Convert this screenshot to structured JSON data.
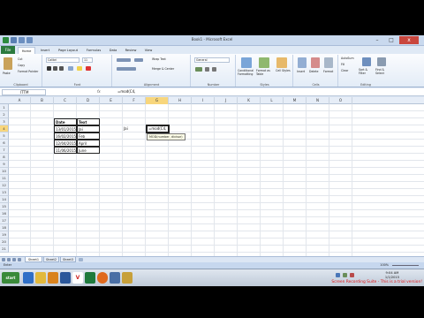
{
  "window": {
    "title": "Book1 - Microsoft Excel",
    "min": "–",
    "max": "□",
    "close": "x"
  },
  "tabs": [
    "File",
    "Home",
    "Insert",
    "Page Layout",
    "Formulas",
    "Data",
    "Review",
    "View"
  ],
  "ribbon": {
    "clipboard": {
      "label": "Clipboard",
      "paste": "Paste",
      "cut": "Cut",
      "copy": "Copy",
      "format_painter": "Format Painter"
    },
    "font": {
      "label": "Font",
      "font_name": "Calibri",
      "font_size": "11"
    },
    "alignment": {
      "label": "Alignment",
      "wrap": "Wrap Text",
      "merge": "Merge & Center"
    },
    "number": {
      "label": "Number",
      "format": "General"
    },
    "styles": {
      "label": "Styles",
      "conditional": "Conditional Formatting",
      "format_table": "Format as Table",
      "cell_styles": "Cell Styles"
    },
    "cells": {
      "label": "Cells",
      "insert": "Insert",
      "delete": "Delete",
      "format": "Format"
    },
    "editing": {
      "label": "Editing",
      "autosum": "AutoSum",
      "fill": "Fill",
      "clear": "Clear",
      "sort": "Sort & Filter",
      "find": "Find & Select"
    }
  },
  "formula_bar": {
    "name_box": "ITTM",
    "fx": "fx",
    "content": "=mod(C4,"
  },
  "columns": [
    "A",
    "B",
    "C",
    "D",
    "E",
    "F",
    "G",
    "H",
    "I",
    "J",
    "K",
    "L",
    "M",
    "N",
    "O"
  ],
  "rows": [
    "1",
    "2",
    "3",
    "4",
    "5",
    "6",
    "7",
    "8",
    "9",
    "10",
    "11",
    "12",
    "13",
    "14",
    "15",
    "16",
    "17",
    "18",
    "19",
    "20",
    "21"
  ],
  "table": {
    "headers": [
      "Date",
      "Text"
    ],
    "rows": [
      [
        "13/01/2015",
        "Jai"
      ],
      [
        "16/02/2015",
        "Feb"
      ],
      [
        "12/04/2015",
        "April"
      ],
      [
        "11/06/2015",
        "June"
      ]
    ]
  },
  "cell_f4": "Jai",
  "active_cell_text": "=mod(C4,",
  "tooltip": "MOD(number, divisor)",
  "sheets": [
    "Sheet1",
    "Sheet2",
    "Sheet3"
  ],
  "status": {
    "mode": "Enter",
    "zoom": "100%"
  },
  "taskbar": {
    "start": "start",
    "apps": [
      "IE",
      "Explorer",
      "Media",
      "Outlook",
      "V",
      "Excel",
      "Firefox",
      "Media2",
      "Paint"
    ],
    "clock_time": "9:04 AM",
    "clock_date": "1/1/2015",
    "watermark": "Screen Recording Suite - This is a trial version!"
  },
  "colors": {
    "file_tab": "#2c7a3e",
    "selected_header": "#f8d67c",
    "watermark": "#dd1111"
  }
}
